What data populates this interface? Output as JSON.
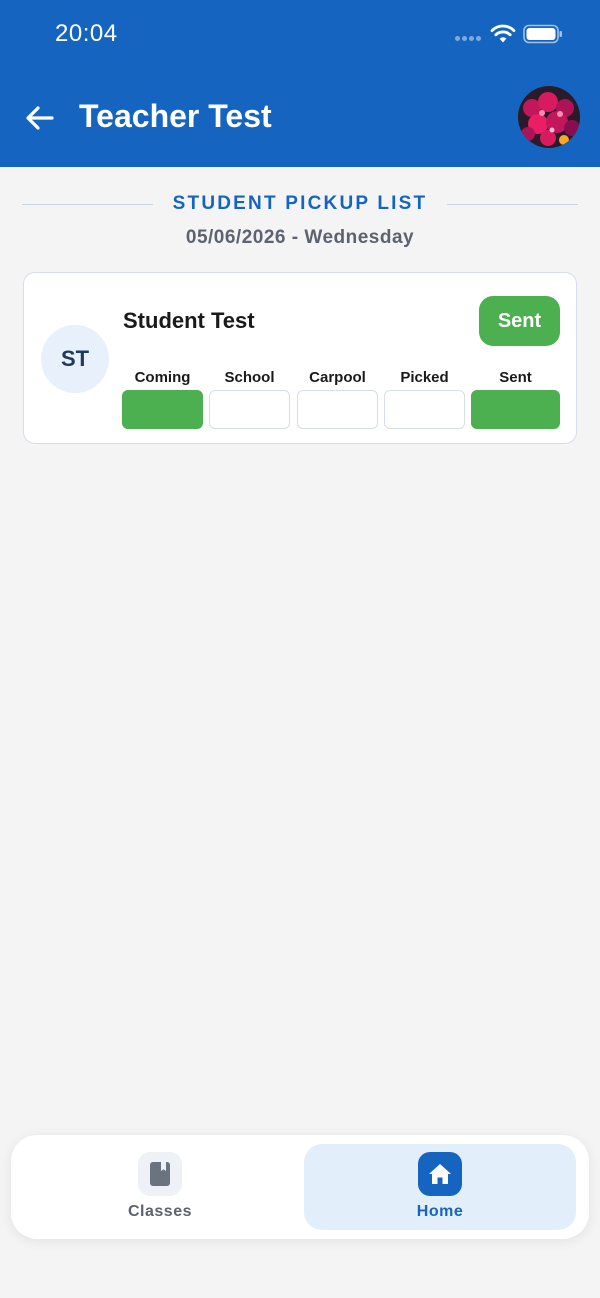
{
  "status_bar": {
    "time": "20:04"
  },
  "header": {
    "title": "Teacher Test"
  },
  "section": {
    "title": "STUDENT PICKUP LIST",
    "date": "05/06/2026 - Wednesday"
  },
  "student": {
    "initials": "ST",
    "name": "Student Test",
    "status_label": "Sent",
    "stages": [
      {
        "label": "Coming",
        "active": true
      },
      {
        "label": "School",
        "active": false
      },
      {
        "label": "Carpool",
        "active": false
      },
      {
        "label": "Picked",
        "active": false
      },
      {
        "label": "Sent",
        "active": true
      }
    ]
  },
  "nav": {
    "classes_label": "Classes",
    "home_label": "Home",
    "active": "Home"
  },
  "colors": {
    "primary": "#1565c0",
    "success": "#4caf50",
    "background": "#f4f4f5"
  }
}
